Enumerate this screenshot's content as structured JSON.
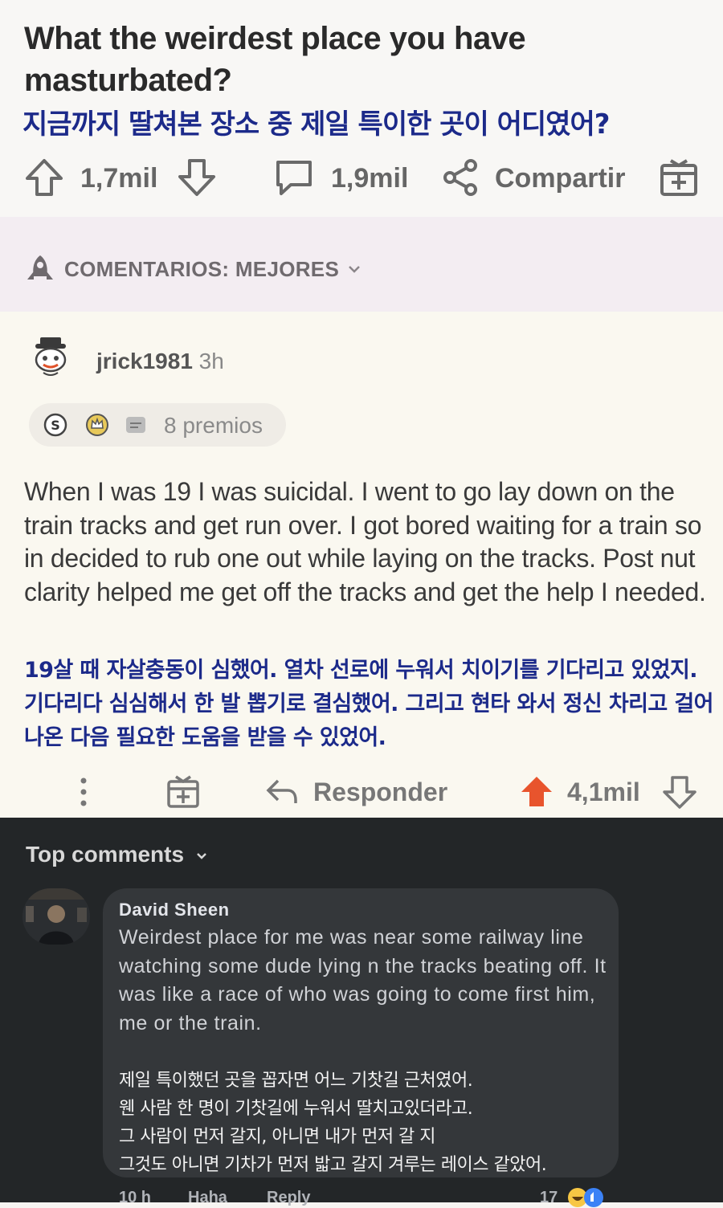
{
  "post": {
    "title": "What the weirdest place you have masturbated?",
    "title_ko": "지금까지 딸쳐본 장소 중 제일 특이한 곳이 어디였어?",
    "upvotes": "1,7mil",
    "comments": "1,9mil",
    "share_label": "Compartir"
  },
  "sort": {
    "label": "COMENTARIOS: MEJORES"
  },
  "comment": {
    "username": "jrick1981",
    "age": "3h",
    "awards_text": "8 premios",
    "body": "When I was 19 I was suicidal. I went to go lay down on the train tracks and get run over. I got bored waiting for a train so in decided to rub one out while laying on the tracks. Post nut clarity helped me get off the tracks and get the help I needed.",
    "body_ko": "19살 때 자살충동이 심했어. 열차 선로에 누워서 치이기를 기다리고 있었지. 기다리다 심심해서 한 발 뽑기로 결심했어. 그리고 현타 와서 정신 차리고 걸어나온 다음 필요한 도움을 받을 수 있었어.",
    "reply_label": "Responder",
    "votes": "4,1mil"
  },
  "fb": {
    "header": "Top comments",
    "name": "David Sheen",
    "text": "Weirdest place for me was near some railway line watching some dude lying n the tracks beating off. It was like a race of who was going to come first him, me or the train.",
    "text_ko": "제일 특이했던 곳을 꼽자면 어느 기찻길 근처였어.\n웬 사람 한 명이 기찻길에 누워서 딸치고있더라고.\n그 사람이 먼저 갈지, 아니면 내가 먼저 갈 지\n그것도 아니면 기차가 먼저 밟고 갈지 겨루는 레이스 같았어.",
    "time": "10 h",
    "haha": "Haha",
    "reply": "Reply",
    "reactions": "17"
  }
}
